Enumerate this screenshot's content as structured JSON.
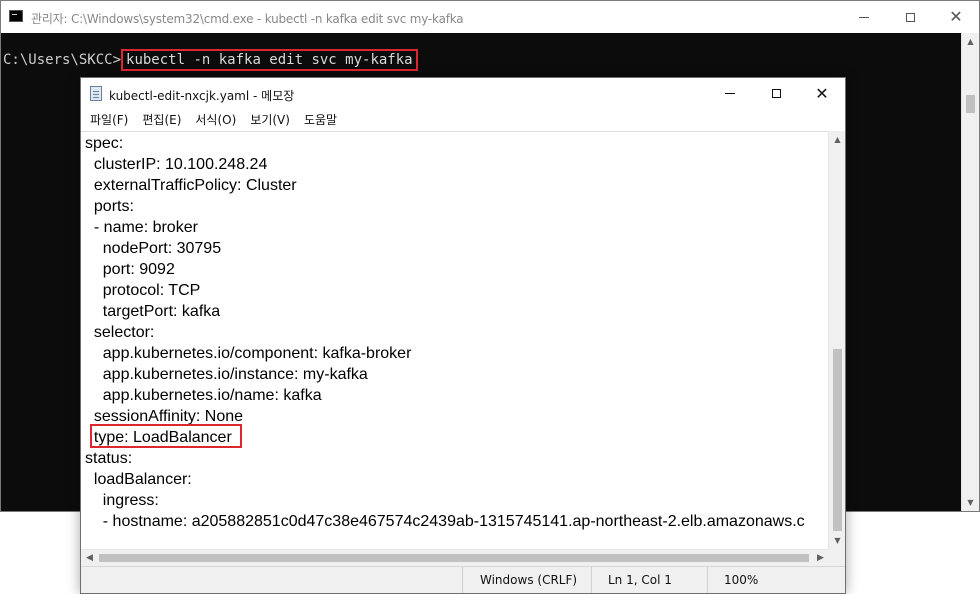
{
  "cmd": {
    "title": "관리자: C:\\Windows\\system32\\cmd.exe - kubectl  -n kafka edit svc my-kafka",
    "prompt": "C:\\Users\\SKCC>",
    "command": "kubectl -n kafka edit svc my-kafka"
  },
  "notepad": {
    "title": "kubectl-edit-nxcjk.yaml - 메모장",
    "menu": [
      "파일(F)",
      "편집(E)",
      "서식(O)",
      "보기(V)",
      "도움말"
    ],
    "lines": [
      "spec:",
      "  clusterIP: 10.100.248.24",
      "  externalTrafficPolicy: Cluster",
      "  ports:",
      "  - name: broker",
      "    nodePort: 30795",
      "    port: 9092",
      "    protocol: TCP",
      "    targetPort: kafka",
      "  selector:",
      "    app.kubernetes.io/component: kafka-broker",
      "    app.kubernetes.io/instance: my-kafka",
      "    app.kubernetes.io/name: kafka",
      "  sessionAffinity: None",
      "  type: LoadBalancer",
      "status:",
      "  loadBalancer:",
      "    ingress:",
      "    - hostname: a205882851c0d47c38e467574c2439ab-1315745141.ap-northeast-2.elb.amazonaws.c"
    ],
    "status": {
      "encoding": "Windows (CRLF)",
      "position": "Ln 1, Col 1",
      "zoom": "100%"
    }
  },
  "colors": {
    "highlight": "#e0262d",
    "console_bg": "#0c0c0c"
  },
  "icons": {
    "cmd_app": "console-app-icon",
    "notepad_app": "notepad-document-icon"
  }
}
